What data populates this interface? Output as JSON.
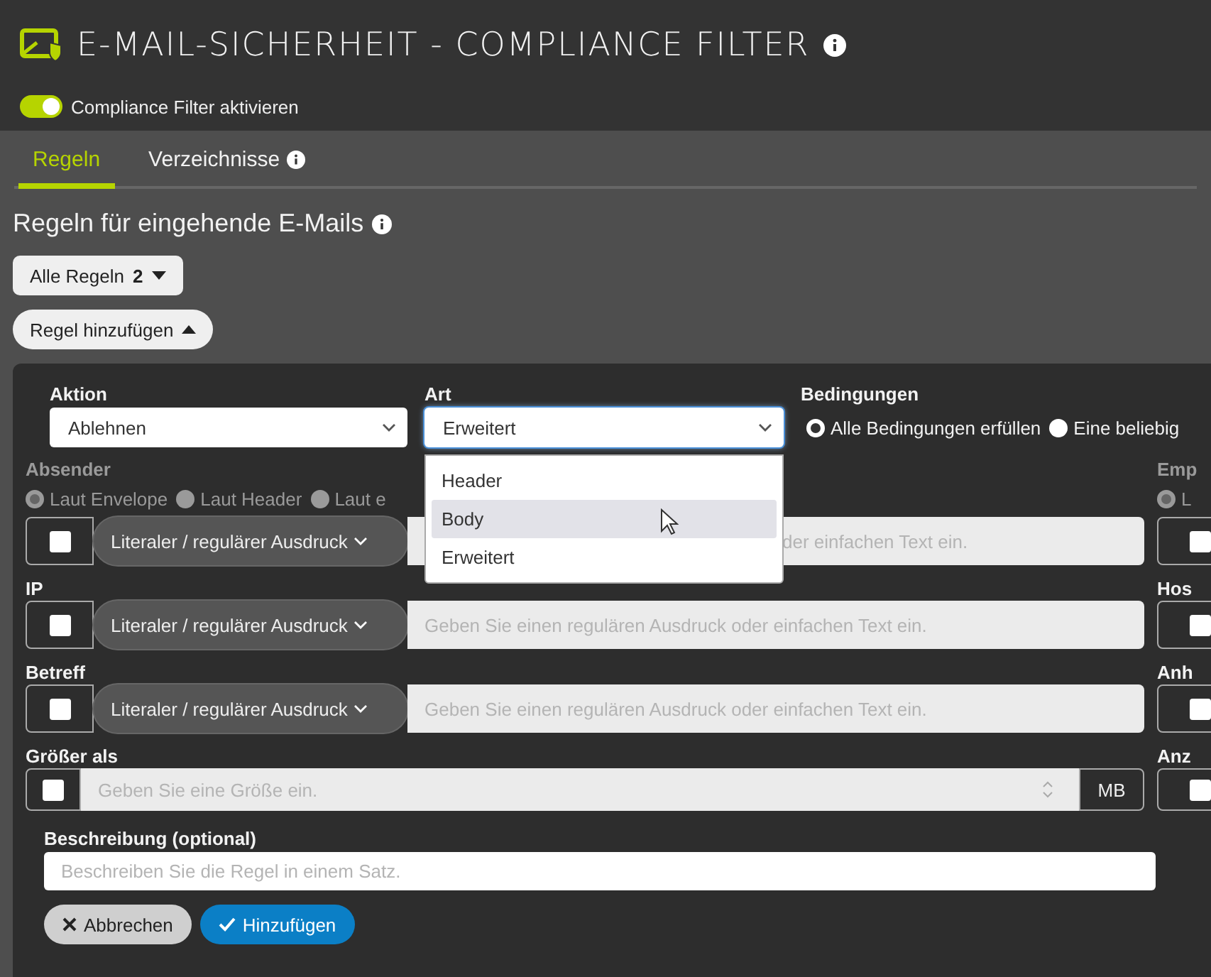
{
  "header": {
    "title": "E-MAIL-SICHERHEIT - COMPLIANCE FILTER",
    "toggle": {
      "label": "Compliance Filter aktivieren",
      "on": true
    }
  },
  "tabs": [
    {
      "label": "Regeln",
      "selected": true,
      "info": false
    },
    {
      "label": "Verzeichnisse",
      "selected": false,
      "info": true
    }
  ],
  "section": {
    "title": "Regeln für eingehende E-Mails"
  },
  "rules_filter": {
    "label": "Alle Regeln",
    "count": "2"
  },
  "add_rule": {
    "label": "Regel hinzufügen",
    "expanded": true
  },
  "form": {
    "aktion": {
      "label": "Aktion",
      "value": "Ablehnen"
    },
    "art": {
      "label": "Art",
      "value": "Erweitert",
      "open": true,
      "options": [
        {
          "label": "Header",
          "hovered": false
        },
        {
          "label": "Body",
          "hovered": true
        },
        {
          "label": "Erweitert",
          "hovered": false
        }
      ]
    },
    "bedingungen": {
      "label": "Bedingungen",
      "options": [
        {
          "label": "Alle Bedingungen erfüllen",
          "selected": true
        },
        {
          "label": "Eine beliebig",
          "selected": false
        }
      ]
    },
    "fields": [
      {
        "kind": "text",
        "label": "Absender",
        "disabled": true,
        "radios": [
          {
            "label": "Laut Envelope",
            "selected": true
          },
          {
            "label": "Laut Header",
            "selected": false
          },
          {
            "label": "Laut e",
            "selected": false
          }
        ],
        "checked": false,
        "mode": "Literaler / regulärer Ausdruck",
        "placeholder": "der einfachen Text ein."
      },
      {
        "kind": "text",
        "label": "IP",
        "disabled": false,
        "checked": false,
        "mode": "Literaler / regulärer Ausdruck",
        "placeholder": "Geben Sie einen regulären Ausdruck oder einfachen Text ein."
      },
      {
        "kind": "text",
        "label": "Betreff",
        "disabled": false,
        "checked": false,
        "mode": "Literaler / regulärer Ausdruck",
        "placeholder": "Geben Sie einen regulären Ausdruck oder einfachen Text ein."
      },
      {
        "kind": "size",
        "label": "Größer als",
        "disabled": false,
        "checked": false,
        "placeholder": "Geben Sie eine Größe ein.",
        "unit": "MB"
      }
    ],
    "side_fields": [
      {
        "label": "Emp",
        "disabled": true,
        "radios": [
          {
            "label": "L",
            "selected": true
          }
        ],
        "checked": false
      },
      {
        "label": "Hos",
        "disabled": false,
        "checked": false
      },
      {
        "label": "Anh",
        "disabled": false,
        "checked": false
      },
      {
        "label": "Anz",
        "disabled": false,
        "checked": false
      }
    ],
    "description": {
      "label": "Beschreibung (optional)",
      "placeholder": "Beschreiben Sie die Regel in einem Satz."
    },
    "buttons": [
      {
        "kind": "cancel",
        "label": "Abbrechen"
      },
      {
        "kind": "submit",
        "label": "Hinzufügen"
      }
    ]
  }
}
